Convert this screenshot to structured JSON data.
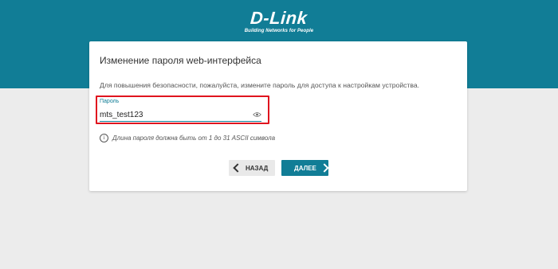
{
  "header": {
    "logo_text": "D-Link",
    "logo_tagline": "Building Networks for People",
    "band_color": "#117d96"
  },
  "dialog": {
    "title": "Изменение пароля web-интерфейса",
    "description": "Для повышения безопасности, пожалуйста, измените пароль для доступа к настройкам устройства.",
    "password_label": "Пароль",
    "password_value": "mts_test123",
    "password_visibility_icon": "eye-icon",
    "hint_icon": "info-icon",
    "hint_text": "Длина пароля должна быть от 1 до 31 ASCII символа",
    "back_button": "НАЗАД",
    "next_button": "ДАЛЕЕ",
    "highlight_color": "#e0141e",
    "accent_color": "#117d96"
  }
}
